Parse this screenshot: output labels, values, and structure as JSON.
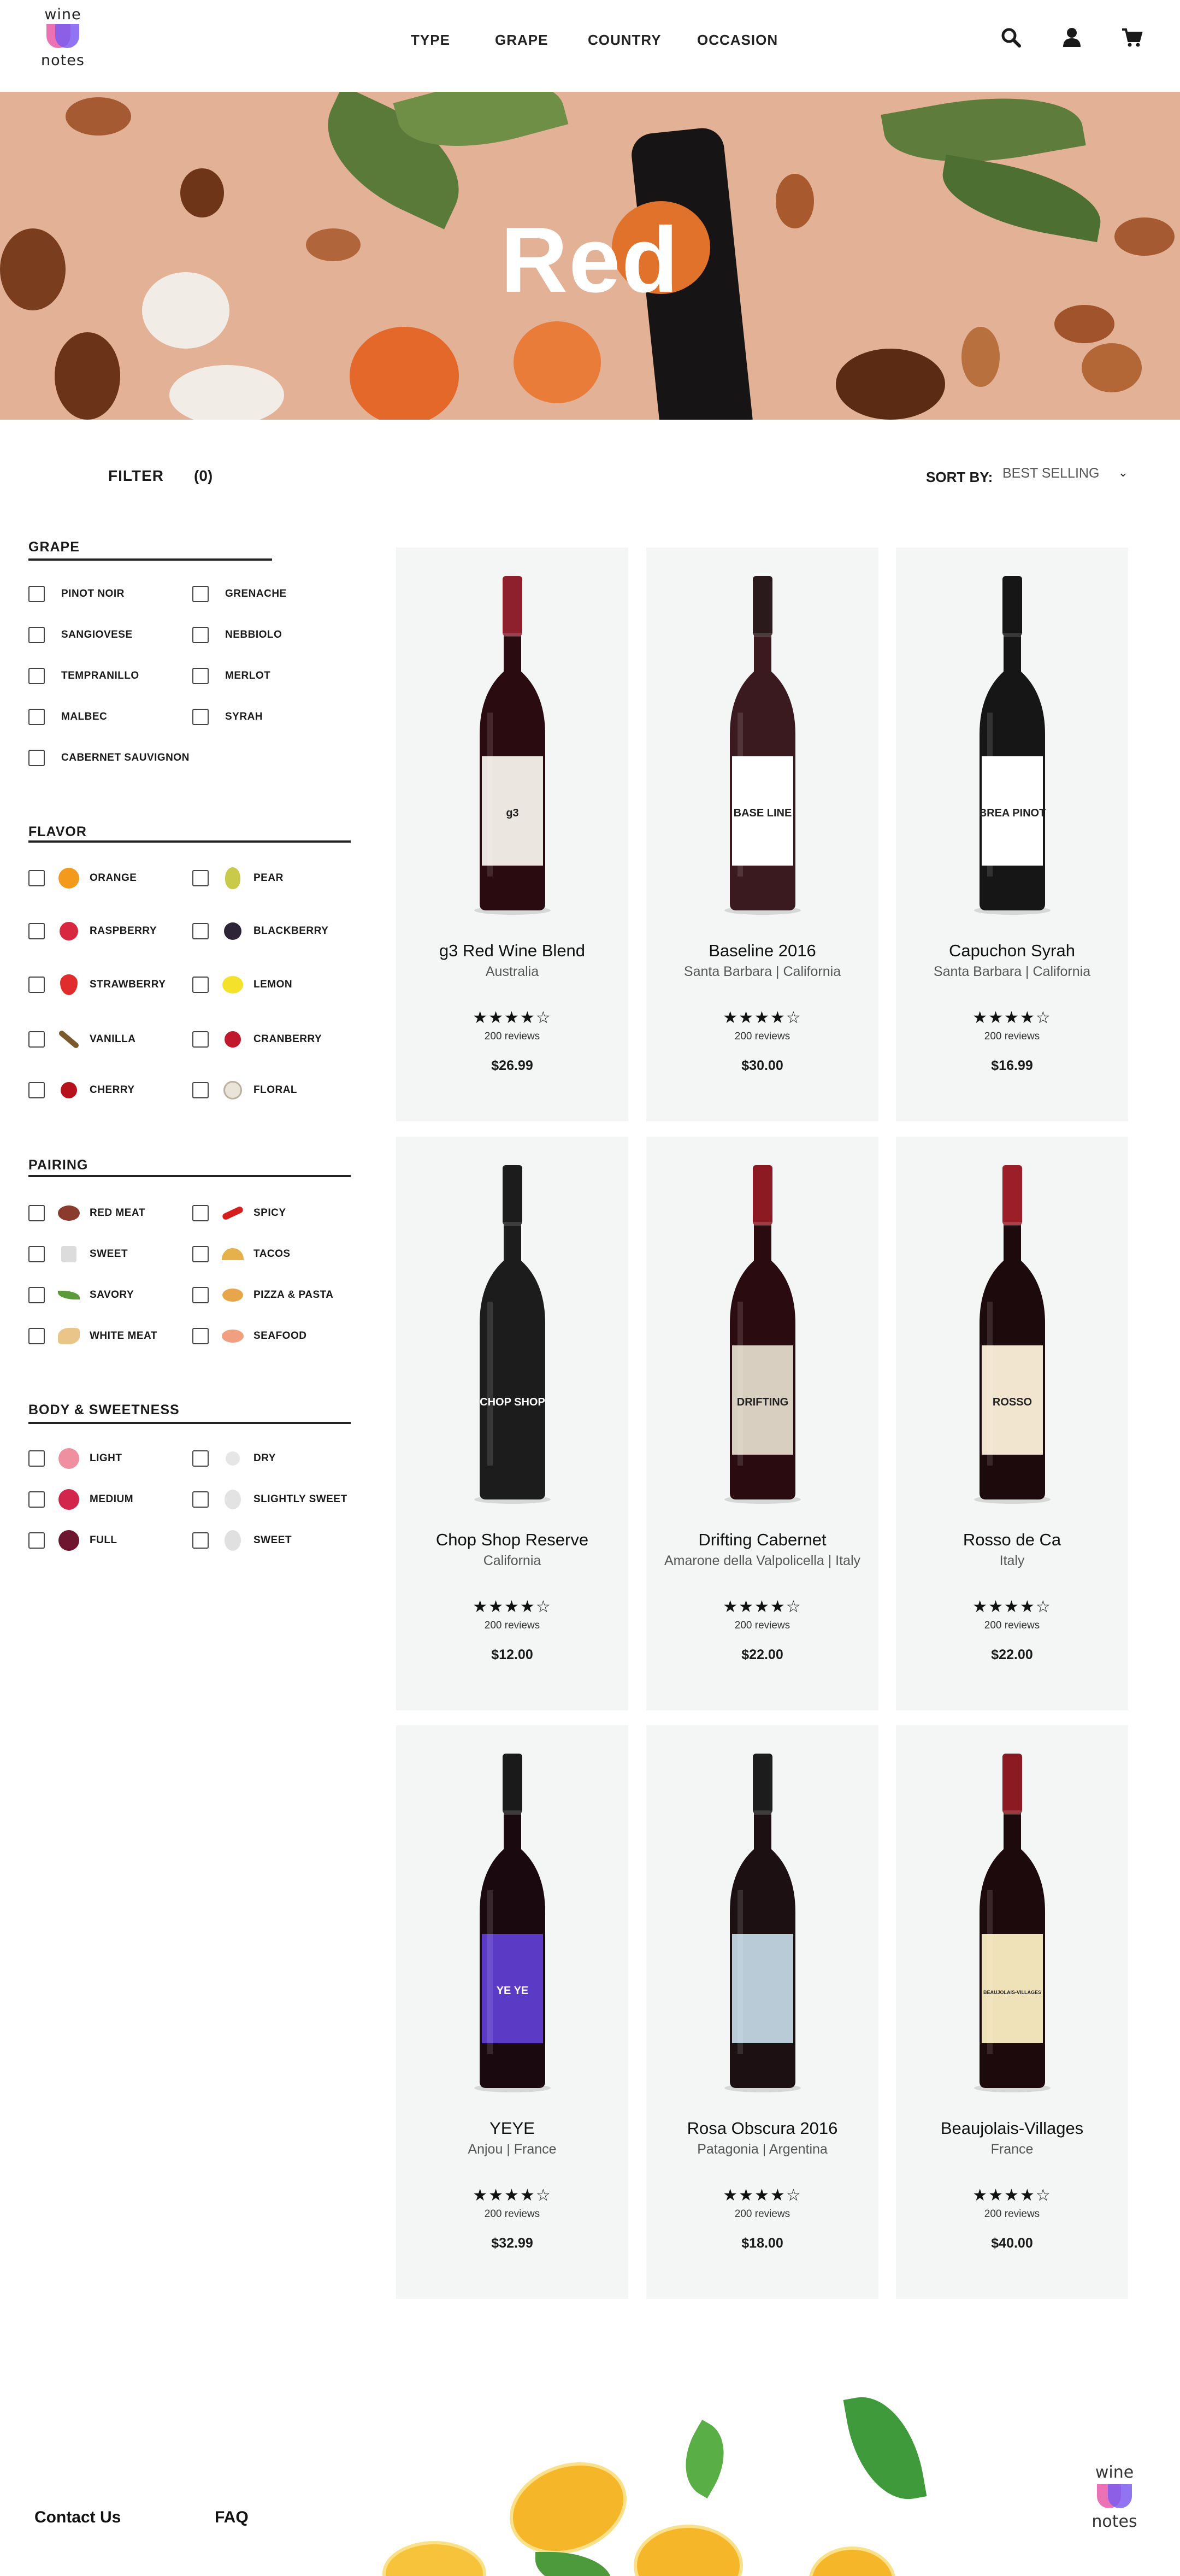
{
  "header": {
    "logo_top": "wine",
    "logo_bottom": "notes",
    "nav": [
      "TYPE",
      "GRAPE",
      "COUNTRY",
      "OCCASION"
    ],
    "icons": [
      "search-icon",
      "user-icon",
      "cart-icon"
    ]
  },
  "hero": {
    "title": "Red"
  },
  "toolbar": {
    "filter_label": "FILTER",
    "filter_count": "(0)",
    "sort_label": "SORT BY:",
    "sort_value": "BEST SELLING"
  },
  "filters": {
    "grape": {
      "title": "GRAPE",
      "options": [
        "PINOT NOIR",
        "GRENACHE",
        "SANGIOVESE",
        "NEBBIOLO",
        "TEMPRANILLO",
        "MERLOT",
        "MALBEC",
        "SYRAH",
        "CABERNET SAUVIGNON"
      ]
    },
    "flavor": {
      "title": "FLAVOR",
      "options": [
        {
          "label": "ORANGE",
          "icon": "orange-icon"
        },
        {
          "label": "PEAR",
          "icon": "pear-icon"
        },
        {
          "label": "RASPBERRY",
          "icon": "raspberry-icon"
        },
        {
          "label": "BLACKBERRY",
          "icon": "blackberry-icon"
        },
        {
          "label": "STRAWBERRY",
          "icon": "strawberry-icon"
        },
        {
          "label": "LEMON",
          "icon": "lemon-icon"
        },
        {
          "label": "VANILLA",
          "icon": "vanilla-icon"
        },
        {
          "label": "CRANBERRY",
          "icon": "cranberry-icon"
        },
        {
          "label": "CHERRY",
          "icon": "cherry-icon"
        },
        {
          "label": "FLORAL",
          "icon": "floral-icon"
        }
      ]
    },
    "pairing": {
      "title": "PAIRING",
      "options": [
        {
          "label": "RED MEAT",
          "icon": "red-meat-icon"
        },
        {
          "label": "SPICY",
          "icon": "chili-icon"
        },
        {
          "label": "SWEET",
          "icon": "sweet-icon"
        },
        {
          "label": "TACOS",
          "icon": "taco-icon"
        },
        {
          "label": "SAVORY",
          "icon": "savory-icon"
        },
        {
          "label": "PIZZA & PASTA",
          "icon": "pizza-icon"
        },
        {
          "label": "WHITE MEAT",
          "icon": "white-meat-icon"
        },
        {
          "label": "SEAFOOD",
          "icon": "seafood-icon"
        }
      ]
    },
    "body": {
      "title": "BODY & SWEETNESS",
      "options": [
        {
          "label": "LIGHT",
          "icon": "light-body-icon",
          "color": "#ef8fa0"
        },
        {
          "label": "DRY",
          "icon": "dry-icon"
        },
        {
          "label": "MEDIUM",
          "icon": "medium-body-icon",
          "color": "#d2264c"
        },
        {
          "label": "SLIGHTLY SWEET",
          "icon": "slightly-sweet-icon"
        },
        {
          "label": "FULL",
          "icon": "full-body-icon",
          "color": "#6e1530"
        },
        {
          "label": "SWEET",
          "icon": "sweet-grape-icon"
        }
      ]
    }
  },
  "products": [
    {
      "name": "g3 Red Wine Blend",
      "region": "Australia",
      "stars": "★★★★☆",
      "reviews": "200 reviews",
      "price": "$26.99",
      "label_text": "g3",
      "label_color": "#ece6e0",
      "capsule": "#8e1f2c",
      "glass": "#2a0c10"
    },
    {
      "name": "Baseline 2016",
      "region": "Santa Barbara | California",
      "stars": "★★★★☆",
      "reviews": "200 reviews",
      "price": "$30.00",
      "label_text": "BASE LINE",
      "label_color": "#ffffff",
      "capsule": "#2b1a1c",
      "glass": "#3a1a1e"
    },
    {
      "name": "Capuchon Syrah",
      "region": "Santa Barbara | California",
      "stars": "★★★★☆",
      "reviews": "200 reviews",
      "price": "$16.99",
      "label_text": "BREA PINOT",
      "label_color": "#ffffff",
      "capsule": "#161616",
      "glass": "#161616"
    },
    {
      "name": "Chop Shop Reserve",
      "region": "California",
      "stars": "★★★★☆",
      "reviews": "200 reviews",
      "price": "$12.00",
      "label_text": "CHOP SHOP",
      "label_color": "#1c1c1c",
      "capsule": "#1c1c1c",
      "glass": "#1c1c1c"
    },
    {
      "name": "Drifting Cabernet",
      "region": "Amarone della Valpolicella |  Italy",
      "stars": "★★★★☆",
      "reviews": "200 reviews",
      "price": "$22.00",
      "label_text": "DRIFTING",
      "label_color": "#d9cfc0",
      "capsule": "#8c1a22",
      "glass": "#2a0c10"
    },
    {
      "name": "Rosso de Ca",
      "region": "Italy",
      "stars": "★★★★☆",
      "reviews": "200 reviews",
      "price": "$22.00",
      "label_text": "ROSSO",
      "label_color": "#f1e5cf",
      "capsule": "#9c1e28",
      "glass": "#1c0a0c"
    },
    {
      "name": "YEYE",
      "region": "Anjou | France",
      "stars": "★★★★☆",
      "reviews": "200 reviews",
      "price": "$32.99",
      "label_text": "YE YE",
      "label_color": "#5b3bc6",
      "capsule": "#1a1a1a",
      "glass": "#1a0a10"
    },
    {
      "name": "Rosa Obscura 2016",
      "region": "Patagonia | Argentina",
      "stars": "★★★★☆",
      "reviews": "200 reviews",
      "price": "$18.00",
      "label_text": "",
      "label_color": "#b9cbd6",
      "capsule": "#1c1c1c",
      "glass": "#1c1012"
    },
    {
      "name": "Beaujolais-Villages",
      "region": "France",
      "stars": "★★★★☆",
      "reviews": "200 reviews",
      "price": "$40.00",
      "label_text": "BEAUJOLAIS-VILLAGES",
      "label_color": "#efe2b8",
      "capsule": "#8c1a22",
      "glass": "#1c0a0c"
    }
  ],
  "footer": {
    "links": [
      "Contact Us",
      "FAQ"
    ],
    "logo_top": "wine",
    "logo_bottom": "notes"
  }
}
